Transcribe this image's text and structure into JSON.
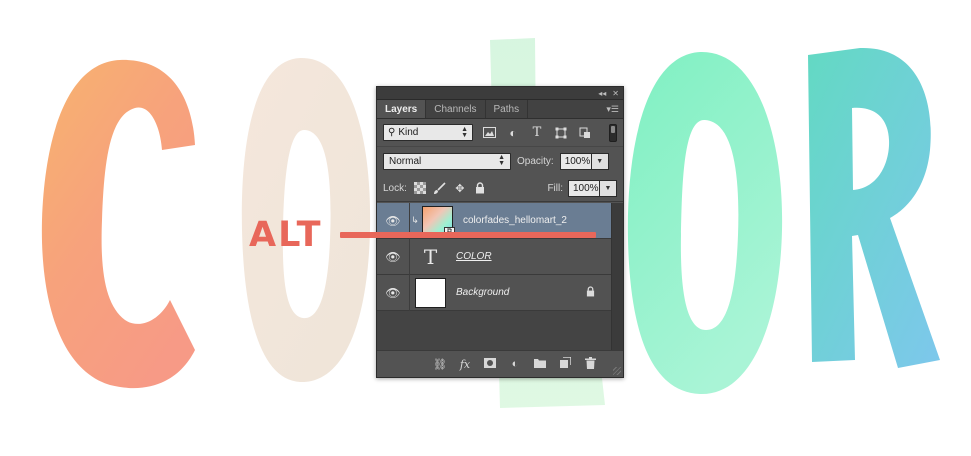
{
  "artwork": {
    "letters": [
      "C",
      "O",
      "L",
      "O",
      "R"
    ]
  },
  "callout": {
    "label": "ALT",
    "color": "#e8675a"
  },
  "panel": {
    "tabs": [
      {
        "label": "Layers",
        "active": true
      },
      {
        "label": "Channels",
        "active": false
      },
      {
        "label": "Paths",
        "active": false
      }
    ],
    "filter": {
      "label": "Kind",
      "icons": [
        "image-filter-icon",
        "adjustment-filter-icon",
        "type-filter-icon",
        "shape-filter-icon",
        "smart-object-filter-icon"
      ]
    },
    "blend_mode": "Normal",
    "opacity_label": "Opacity:",
    "opacity_value": "100%",
    "lock_label": "Lock:",
    "fill_label": "Fill:",
    "fill_value": "100%",
    "layers": [
      {
        "name": "colorfades_hellomart_2",
        "type": "smart-object",
        "selected": true,
        "clipped": true
      },
      {
        "name": "COLOR",
        "type": "text",
        "selected": false
      },
      {
        "name": "Background",
        "type": "background",
        "selected": false,
        "locked": true
      }
    ],
    "footer_icons": [
      "link-icon",
      "fx-icon",
      "mask-icon",
      "adjustment-icon",
      "folder-icon",
      "new-layer-icon",
      "trash-icon"
    ],
    "footer_fx": "fx"
  },
  "colors": {
    "panel_bg": "#535353",
    "selected_layer": "#6a7d93",
    "accent": "#e8675a"
  }
}
